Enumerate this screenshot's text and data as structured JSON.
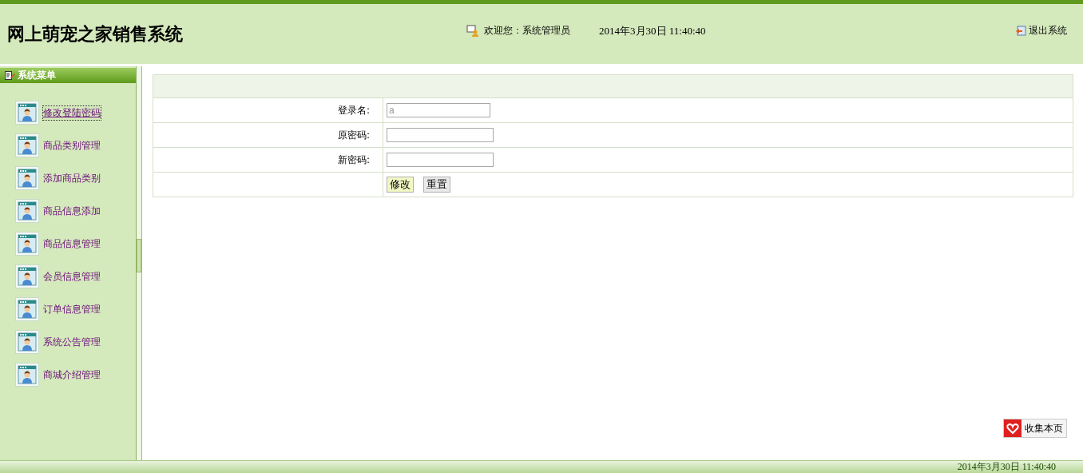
{
  "header": {
    "title": "网上萌宠之家销售系统",
    "welcome": "欢迎您：系统管理员",
    "datetime": "2014年3月30日  11:40:40",
    "logout": "退出系统"
  },
  "sidebar": {
    "title": "系统菜单",
    "items": [
      {
        "label": "修改登陆密码",
        "selected": true
      },
      {
        "label": "商品类别管理",
        "selected": false
      },
      {
        "label": "添加商品类别",
        "selected": false
      },
      {
        "label": "商品信息添加",
        "selected": false
      },
      {
        "label": "商品信息管理",
        "selected": false
      },
      {
        "label": "会员信息管理",
        "selected": false
      },
      {
        "label": "订单信息管理",
        "selected": false
      },
      {
        "label": "系统公告管理",
        "selected": false
      },
      {
        "label": "商城介绍管理",
        "selected": false
      }
    ]
  },
  "form": {
    "fields": [
      {
        "label": "登录名:",
        "value": "a",
        "disabled": true
      },
      {
        "label": "原密码:",
        "disabled": false
      },
      {
        "label": "新密码:",
        "disabled": false
      }
    ],
    "buttons": [
      {
        "label": "修改",
        "highlighted": true
      },
      {
        "label": "重置",
        "highlighted": false
      }
    ]
  },
  "bookmark": {
    "label": "收集本页"
  },
  "status_bar": {
    "datetime": "2014年3月30日  11:40:40"
  }
}
